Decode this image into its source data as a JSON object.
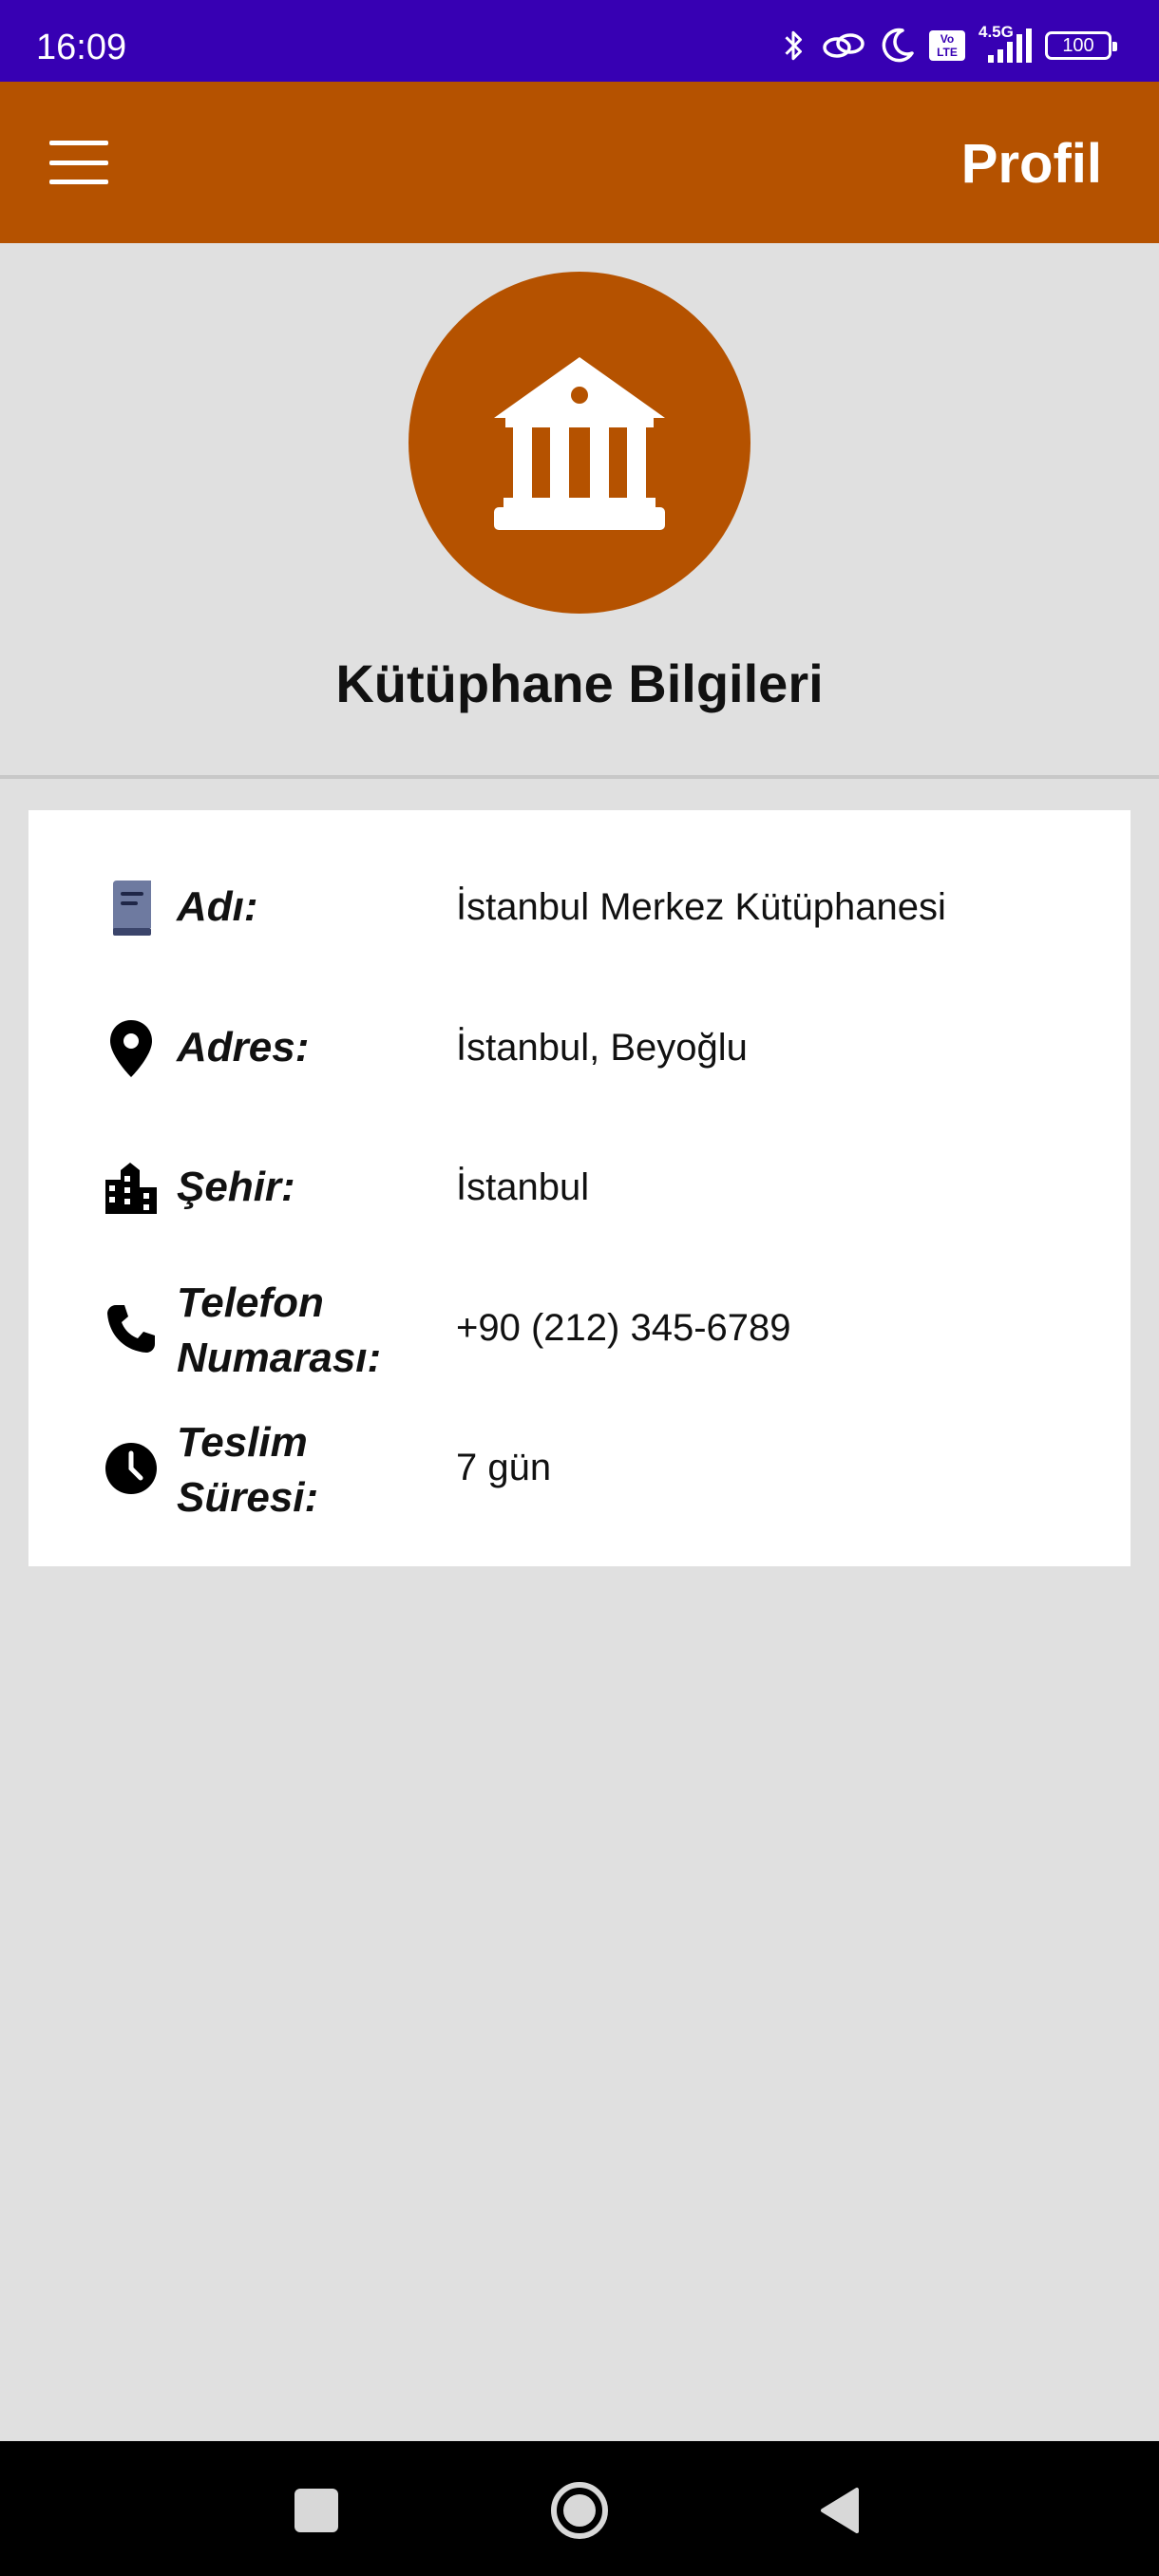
{
  "status_bar": {
    "time": "16:09",
    "network": "4.5G",
    "volte": "Vo LTE",
    "battery": "100"
  },
  "app_bar": {
    "title": "Profil",
    "background": "#b55200"
  },
  "header": {
    "icon": "library-building-icon",
    "title": "Kütüphane Bilgileri"
  },
  "info": {
    "rows": [
      {
        "icon": "book-icon",
        "label": "Adı:",
        "value": "İstanbul Merkez Kütüphanesi"
      },
      {
        "icon": "location-pin-icon",
        "label": "Adres:",
        "value": "İstanbul, Beyoğlu"
      },
      {
        "icon": "city-building-icon",
        "label": "Şehir:",
        "value": "İstanbul"
      },
      {
        "icon": "phone-icon",
        "label_line1": "Telefon",
        "label_line2": "Numarası:",
        "value": "+90 (212) 345-6789"
      },
      {
        "icon": "clock-icon",
        "label_line1": "Teslim",
        "label_line2": "Süresi:",
        "value": "7 gün"
      }
    ]
  },
  "colors": {
    "status_bar": "#3700b3",
    "accent": "#b55200",
    "background": "#e0e0e0",
    "card": "#ffffff"
  }
}
